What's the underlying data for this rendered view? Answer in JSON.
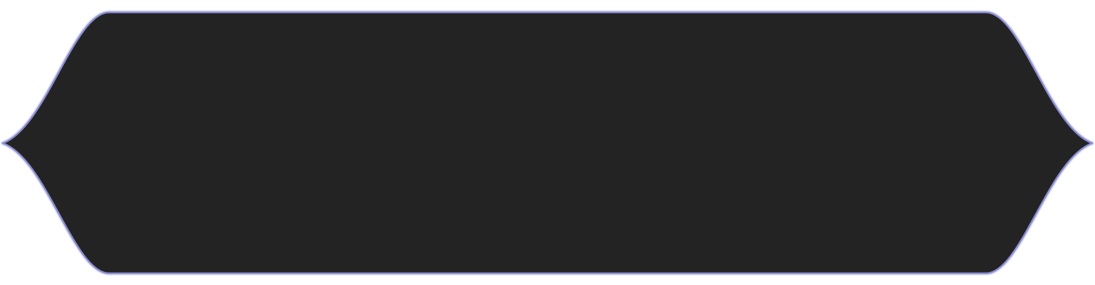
{
  "panel": {
    "fill_color": "#232323",
    "border_color": "#8a8cd0",
    "border_glow_color": "#b9bbe8",
    "background_color": "#ffffff"
  }
}
